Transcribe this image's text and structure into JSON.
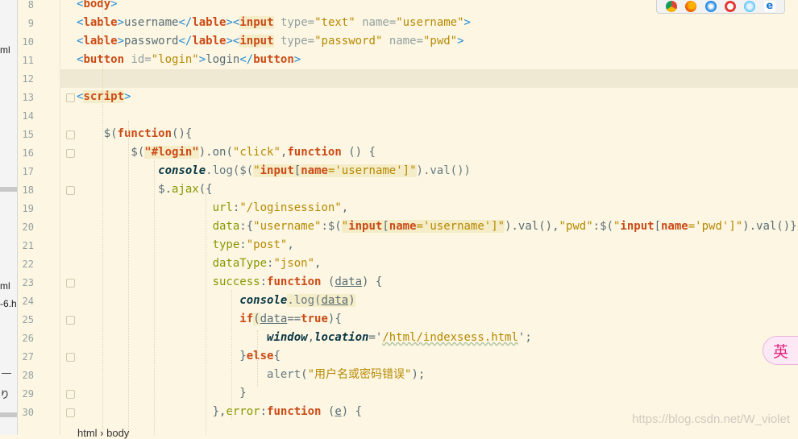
{
  "left_panel": {
    "fragments": [
      "ml",
      "ml",
      "-6.h",
      "り"
    ]
  },
  "gutter": {
    "line_numbers": [
      "8",
      "9",
      "10",
      "11",
      "12",
      "13",
      "14",
      "15",
      "16",
      "17",
      "18",
      "19",
      "20",
      "21",
      "22",
      "23",
      "24",
      "25",
      "26",
      "27",
      "28",
      "29",
      "30"
    ]
  },
  "editor": {
    "current_line": "12",
    "lines": [
      {
        "n": "8",
        "tokens": [
          {
            "t": "<",
            "c": "tag"
          },
          {
            "t": "body",
            "c": "tn"
          },
          {
            "t": ">",
            "c": "tag"
          }
        ]
      },
      {
        "n": "9",
        "tokens": [
          {
            "t": "<",
            "c": "tag"
          },
          {
            "t": "lable",
            "c": "tn"
          },
          {
            "t": ">",
            "c": "tag"
          },
          {
            "t": "username",
            "c": ""
          },
          {
            "t": "</",
            "c": "tag"
          },
          {
            "t": "lable",
            "c": "tn"
          },
          {
            "t": ">",
            "c": "tag"
          },
          {
            "t": "<",
            "c": "tag"
          },
          {
            "t": "input",
            "c": "tn hl"
          },
          {
            "t": " type=",
            "c": "at"
          },
          {
            "t": "\"text\"",
            "c": "av"
          },
          {
            "t": " name=",
            "c": "at"
          },
          {
            "t": "\"username\"",
            "c": "av"
          },
          {
            "t": ">",
            "c": "tag"
          }
        ]
      },
      {
        "n": "10",
        "tokens": [
          {
            "t": "<",
            "c": "tag"
          },
          {
            "t": "lable",
            "c": "tn"
          },
          {
            "t": ">",
            "c": "tag"
          },
          {
            "t": "password",
            "c": ""
          },
          {
            "t": "</",
            "c": "tag"
          },
          {
            "t": "lable",
            "c": "tn"
          },
          {
            "t": ">",
            "c": "tag"
          },
          {
            "t": "<",
            "c": "tag"
          },
          {
            "t": "input",
            "c": "tn hl"
          },
          {
            "t": " type=",
            "c": "at"
          },
          {
            "t": "\"password\"",
            "c": "av"
          },
          {
            "t": " name=",
            "c": "at"
          },
          {
            "t": "\"pwd\"",
            "c": "av"
          },
          {
            "t": ">",
            "c": "tag"
          }
        ]
      },
      {
        "n": "11",
        "tokens": [
          {
            "t": "<",
            "c": "tag"
          },
          {
            "t": "button",
            "c": "tn"
          },
          {
            "t": " id=",
            "c": "at"
          },
          {
            "t": "\"login\"",
            "c": "av"
          },
          {
            "t": ">",
            "c": "tag"
          },
          {
            "t": "login",
            "c": ""
          },
          {
            "t": "</",
            "c": "tag"
          },
          {
            "t": "button",
            "c": "tn"
          },
          {
            "t": ">",
            "c": "tag"
          }
        ]
      },
      {
        "n": "12",
        "tokens": []
      },
      {
        "n": "13",
        "tokens": [
          {
            "t": "<",
            "c": "tag"
          },
          {
            "t": "script",
            "c": "tn hl"
          },
          {
            "t": ">",
            "c": "tag"
          }
        ]
      },
      {
        "n": "14",
        "tokens": []
      },
      {
        "n": "15",
        "tokens": [
          {
            "t": "    $(",
            "c": ""
          },
          {
            "t": "function",
            "c": "kw"
          },
          {
            "t": "(){",
            "c": ""
          }
        ]
      },
      {
        "n": "16",
        "tokens": [
          {
            "t": "        $(",
            "c": ""
          },
          {
            "t": "\"#login\"",
            "c": "sel hl"
          },
          {
            "t": ").on(",
            "c": ""
          },
          {
            "t": "\"click\"",
            "c": "av"
          },
          {
            "t": ",",
            "c": ""
          },
          {
            "t": "function",
            "c": "kw"
          },
          {
            "t": " () {",
            "c": ""
          }
        ]
      },
      {
        "n": "17",
        "tokens": [
          {
            "t": "            ",
            "c": ""
          },
          {
            "t": "console",
            "c": "kwi"
          },
          {
            "t": ".log($(",
            "c": "fn"
          },
          {
            "t": "\"",
            "c": "av hl"
          },
          {
            "t": "input",
            "c": "kw hl"
          },
          {
            "t": "[",
            "c": "hl"
          },
          {
            "t": "name",
            "c": "kw hl"
          },
          {
            "t": "='username']\"",
            "c": "av hl"
          },
          {
            "t": ").val())",
            "c": "fn"
          }
        ]
      },
      {
        "n": "18",
        "tokens": [
          {
            "t": "            $.",
            "c": ""
          },
          {
            "t": "ajax",
            "c": "prop"
          },
          {
            "t": "({",
            "c": ""
          }
        ]
      },
      {
        "n": "19",
        "tokens": [
          {
            "t": "                    ",
            "c": ""
          },
          {
            "t": "url",
            "c": "prop"
          },
          {
            "t": ":",
            "c": ""
          },
          {
            "t": "\"/loginsession\"",
            "c": "av"
          },
          {
            "t": ",",
            "c": ""
          }
        ]
      },
      {
        "n": "20",
        "tokens": [
          {
            "t": "                    ",
            "c": ""
          },
          {
            "t": "data",
            "c": "prop"
          },
          {
            "t": ":{",
            "c": ""
          },
          {
            "t": "\"username\"",
            "c": "av"
          },
          {
            "t": ":$(",
            "c": ""
          },
          {
            "t": "\"",
            "c": "av hl"
          },
          {
            "t": "input",
            "c": "kw hl"
          },
          {
            "t": "[",
            "c": "hl"
          },
          {
            "t": "name",
            "c": "kw hl"
          },
          {
            "t": "='username']\"",
            "c": "av hl"
          },
          {
            "t": ").val(),",
            "c": ""
          },
          {
            "t": "\"pwd\"",
            "c": "av"
          },
          {
            "t": ":$(",
            "c": ""
          },
          {
            "t": "\"",
            "c": "av"
          },
          {
            "t": "input",
            "c": "kw"
          },
          {
            "t": "[",
            "c": ""
          },
          {
            "t": "name",
            "c": "kw"
          },
          {
            "t": "='pwd']\"",
            "c": "av"
          },
          {
            "t": ").val()},",
            "c": ""
          }
        ]
      },
      {
        "n": "21",
        "tokens": [
          {
            "t": "                    ",
            "c": ""
          },
          {
            "t": "type",
            "c": "prop"
          },
          {
            "t": ":",
            "c": ""
          },
          {
            "t": "\"post\"",
            "c": "av"
          },
          {
            "t": ",",
            "c": ""
          }
        ]
      },
      {
        "n": "22",
        "tokens": [
          {
            "t": "                    ",
            "c": ""
          },
          {
            "t": "dataType",
            "c": "prop"
          },
          {
            "t": ":",
            "c": ""
          },
          {
            "t": "\"json\"",
            "c": "av"
          },
          {
            "t": ",",
            "c": ""
          }
        ]
      },
      {
        "n": "23",
        "tokens": [
          {
            "t": "                    ",
            "c": ""
          },
          {
            "t": "success",
            "c": "prop"
          },
          {
            "t": ":",
            "c": ""
          },
          {
            "t": "function",
            "c": "kw"
          },
          {
            "t": " (",
            "c": ""
          },
          {
            "t": "data",
            "c": "un"
          },
          {
            "t": ") {",
            "c": ""
          }
        ]
      },
      {
        "n": "24",
        "tokens": [
          {
            "t": "                        ",
            "c": ""
          },
          {
            "t": "console",
            "c": "kwi"
          },
          {
            "t": ".log(",
            "c": "fn hl"
          },
          {
            "t": "data",
            "c": "un hl"
          },
          {
            "t": ")",
            "c": "hl"
          }
        ]
      },
      {
        "n": "25",
        "tokens": [
          {
            "t": "                        ",
            "c": ""
          },
          {
            "t": "if",
            "c": "kw"
          },
          {
            "t": "(",
            "c": "hl"
          },
          {
            "t": "data",
            "c": "un"
          },
          {
            "t": "==",
            "c": ""
          },
          {
            "t": "true",
            "c": "kw"
          },
          {
            "t": "){",
            "c": ""
          }
        ]
      },
      {
        "n": "26",
        "tokens": [
          {
            "t": "                            ",
            "c": ""
          },
          {
            "t": "window",
            "c": "kwi"
          },
          {
            "t": ",",
            "c": ""
          },
          {
            "t": "location",
            "c": "kwi"
          },
          {
            "t": "='",
            "c": ""
          },
          {
            "t": "/html/indexsess.html",
            "c": "av wavy"
          },
          {
            "t": "';",
            "c": ""
          }
        ]
      },
      {
        "n": "27",
        "tokens": [
          {
            "t": "                        }",
            "c": ""
          },
          {
            "t": "else",
            "c": "kw"
          },
          {
            "t": "{",
            "c": ""
          }
        ]
      },
      {
        "n": "28",
        "tokens": [
          {
            "t": "                            ",
            "c": ""
          },
          {
            "t": "alert",
            "c": "fn"
          },
          {
            "t": "(",
            "c": ""
          },
          {
            "t": "\"用户名或密码错误\"",
            "c": "av"
          },
          {
            "t": ");",
            "c": ""
          }
        ]
      },
      {
        "n": "29",
        "tokens": [
          {
            "t": "                        }",
            "c": ""
          }
        ]
      },
      {
        "n": "30",
        "tokens": [
          {
            "t": "                    },",
            "c": ""
          },
          {
            "t": "error",
            "c": "prop"
          },
          {
            "t": ":",
            "c": ""
          },
          {
            "t": "function",
            "c": "kw"
          },
          {
            "t": " (",
            "c": ""
          },
          {
            "t": "e",
            "c": "un"
          },
          {
            "t": ") {",
            "c": ""
          }
        ]
      }
    ]
  },
  "browser_icons": [
    "chrome-icon",
    "firefox-icon",
    "safari-icon",
    "opera-icon",
    "ie-icon",
    "edge-icon"
  ],
  "ime_indicator": "英",
  "breadcrumb": "html  ›  body",
  "watermark": "https://blog.csdn.net/W_violet"
}
